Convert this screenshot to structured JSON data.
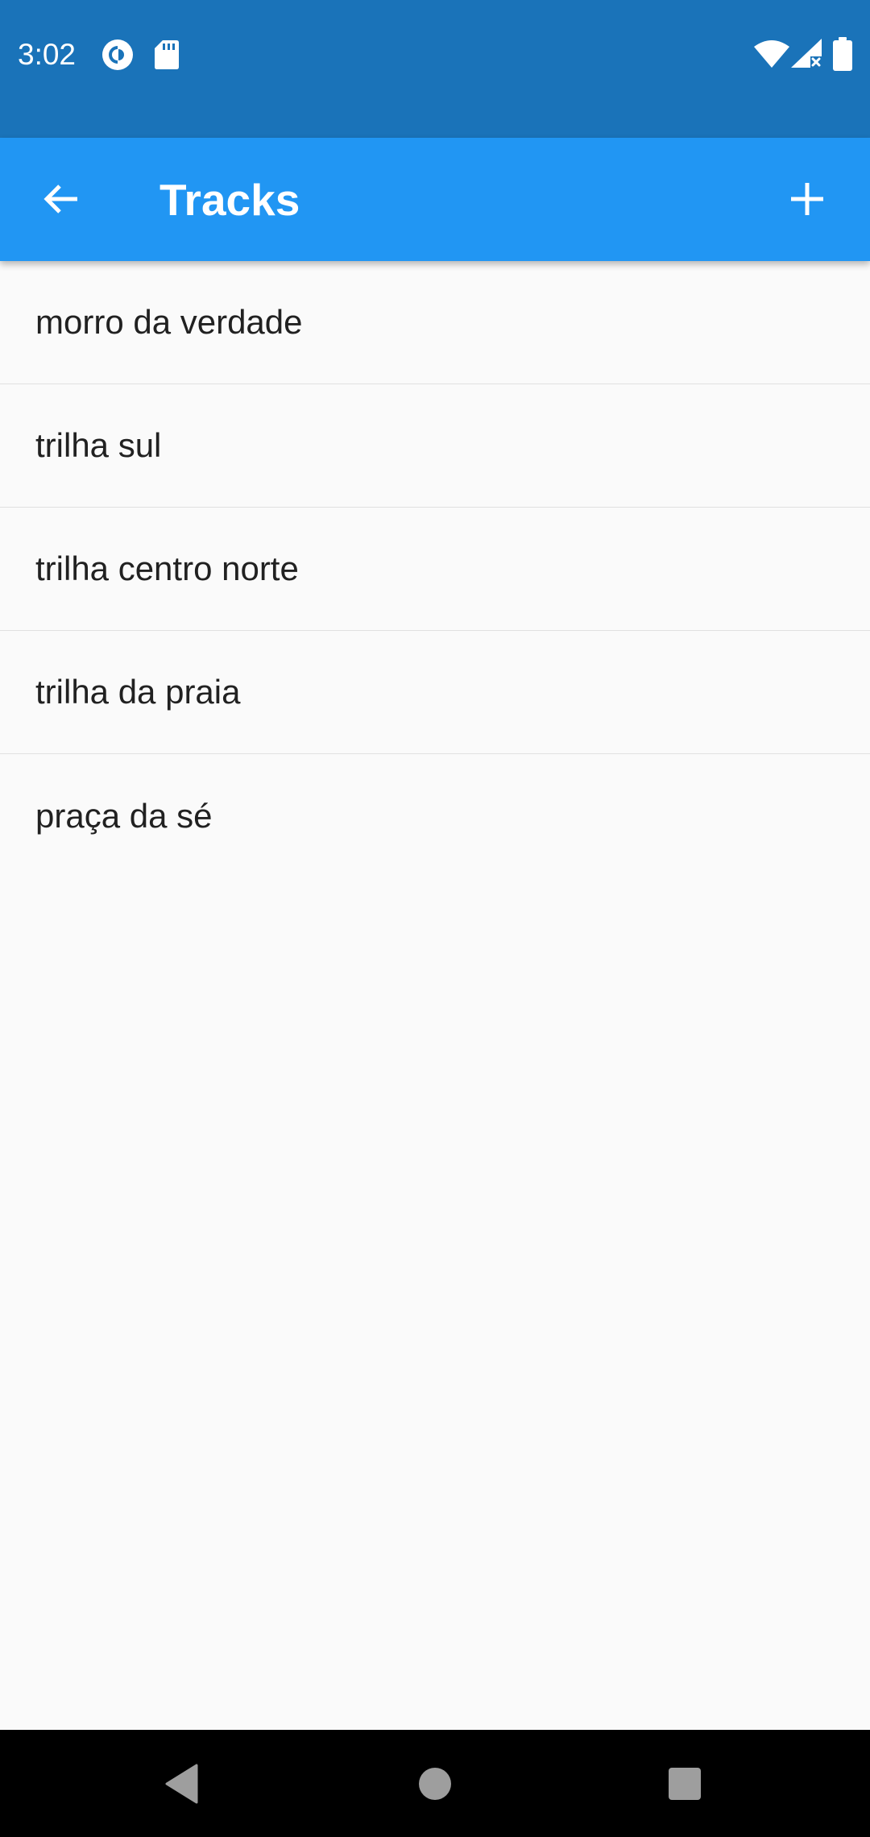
{
  "status_bar": {
    "time": "3:02",
    "icons": [
      "pocket-casts-icon",
      "sd-card-icon",
      "wifi-icon",
      "signal-no-data-icon",
      "battery-icon"
    ],
    "background_color": "#1a73b9"
  },
  "app_bar": {
    "title": "Tracks",
    "back_icon": "arrow-left-icon",
    "add_icon": "plus-icon",
    "background_color": "#2196f3"
  },
  "tracks": [
    {
      "label": "morro da verdade"
    },
    {
      "label": "trilha sul"
    },
    {
      "label": "trilha centro norte"
    },
    {
      "label": "trilha da praia"
    },
    {
      "label": "praça da sé"
    }
  ],
  "nav_bar": {
    "icons": [
      "back-triangle-icon",
      "home-circle-icon",
      "recents-square-icon"
    ]
  }
}
